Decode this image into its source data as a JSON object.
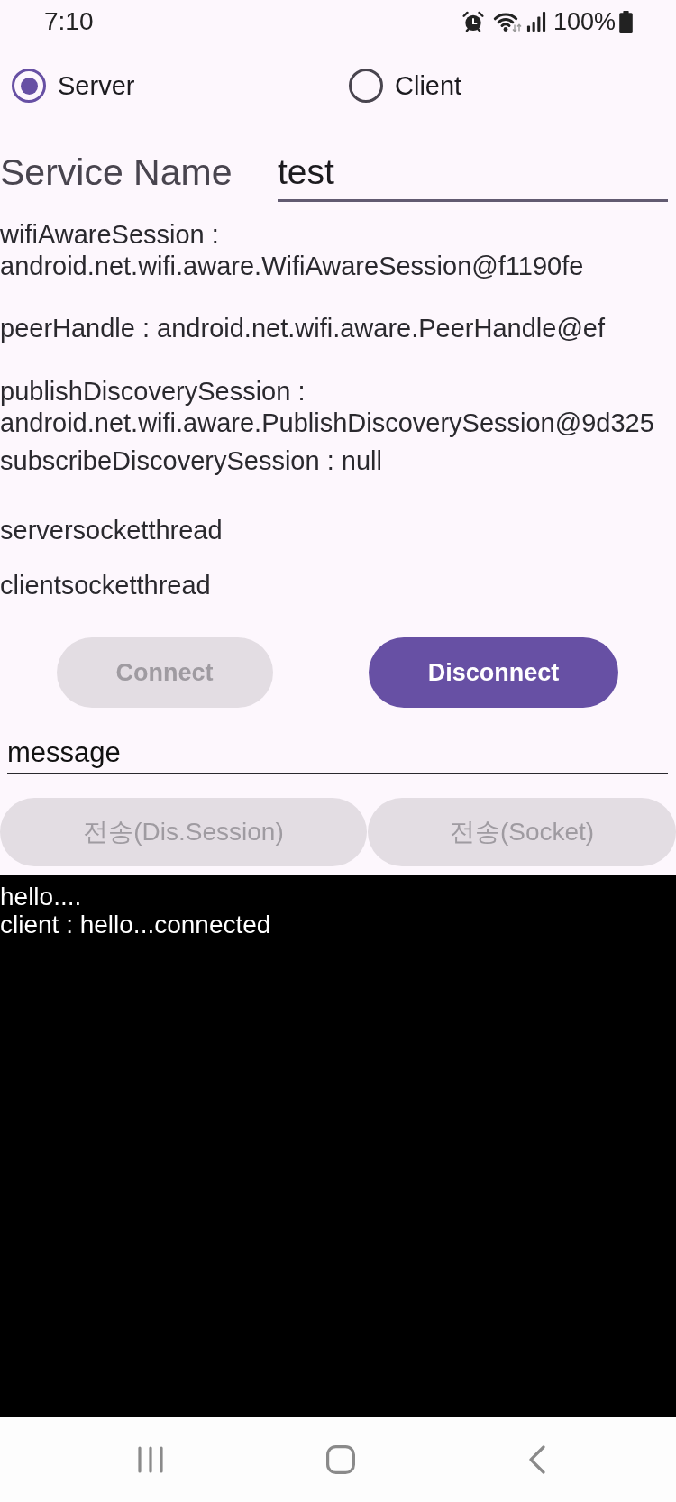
{
  "status_bar": {
    "time": "7:10",
    "battery_text": "100%"
  },
  "mode_options": [
    {
      "label": "Server",
      "selected": true
    },
    {
      "label": "Client",
      "selected": false
    }
  ],
  "service_name": {
    "label": "Service Name",
    "value": "test"
  },
  "info_lines": [
    "wifiAwareSession : android.net.wifi.aware.WifiAwareSession@f1190fe",
    "peerHandle : android.net.wifi.aware.PeerHandle@ef",
    "publishDiscoverySession : android.net.wifi.aware.PublishDiscoverySession@9d325",
    "subscribeDiscoverySession : null",
    "serversocketthread",
    "clientsocketthread"
  ],
  "connection_buttons": [
    {
      "label": "Connect",
      "disabled": true
    },
    {
      "label": "Disconnect",
      "disabled": false
    }
  ],
  "message_field": {
    "value": "message"
  },
  "send_buttons": [
    {
      "label": "전송(Dis.Session)",
      "disabled": true
    },
    {
      "label": "전송(Socket)",
      "disabled": true
    }
  ],
  "log": {
    "lines": [
      "hello....",
      "client : hello...connected"
    ]
  }
}
